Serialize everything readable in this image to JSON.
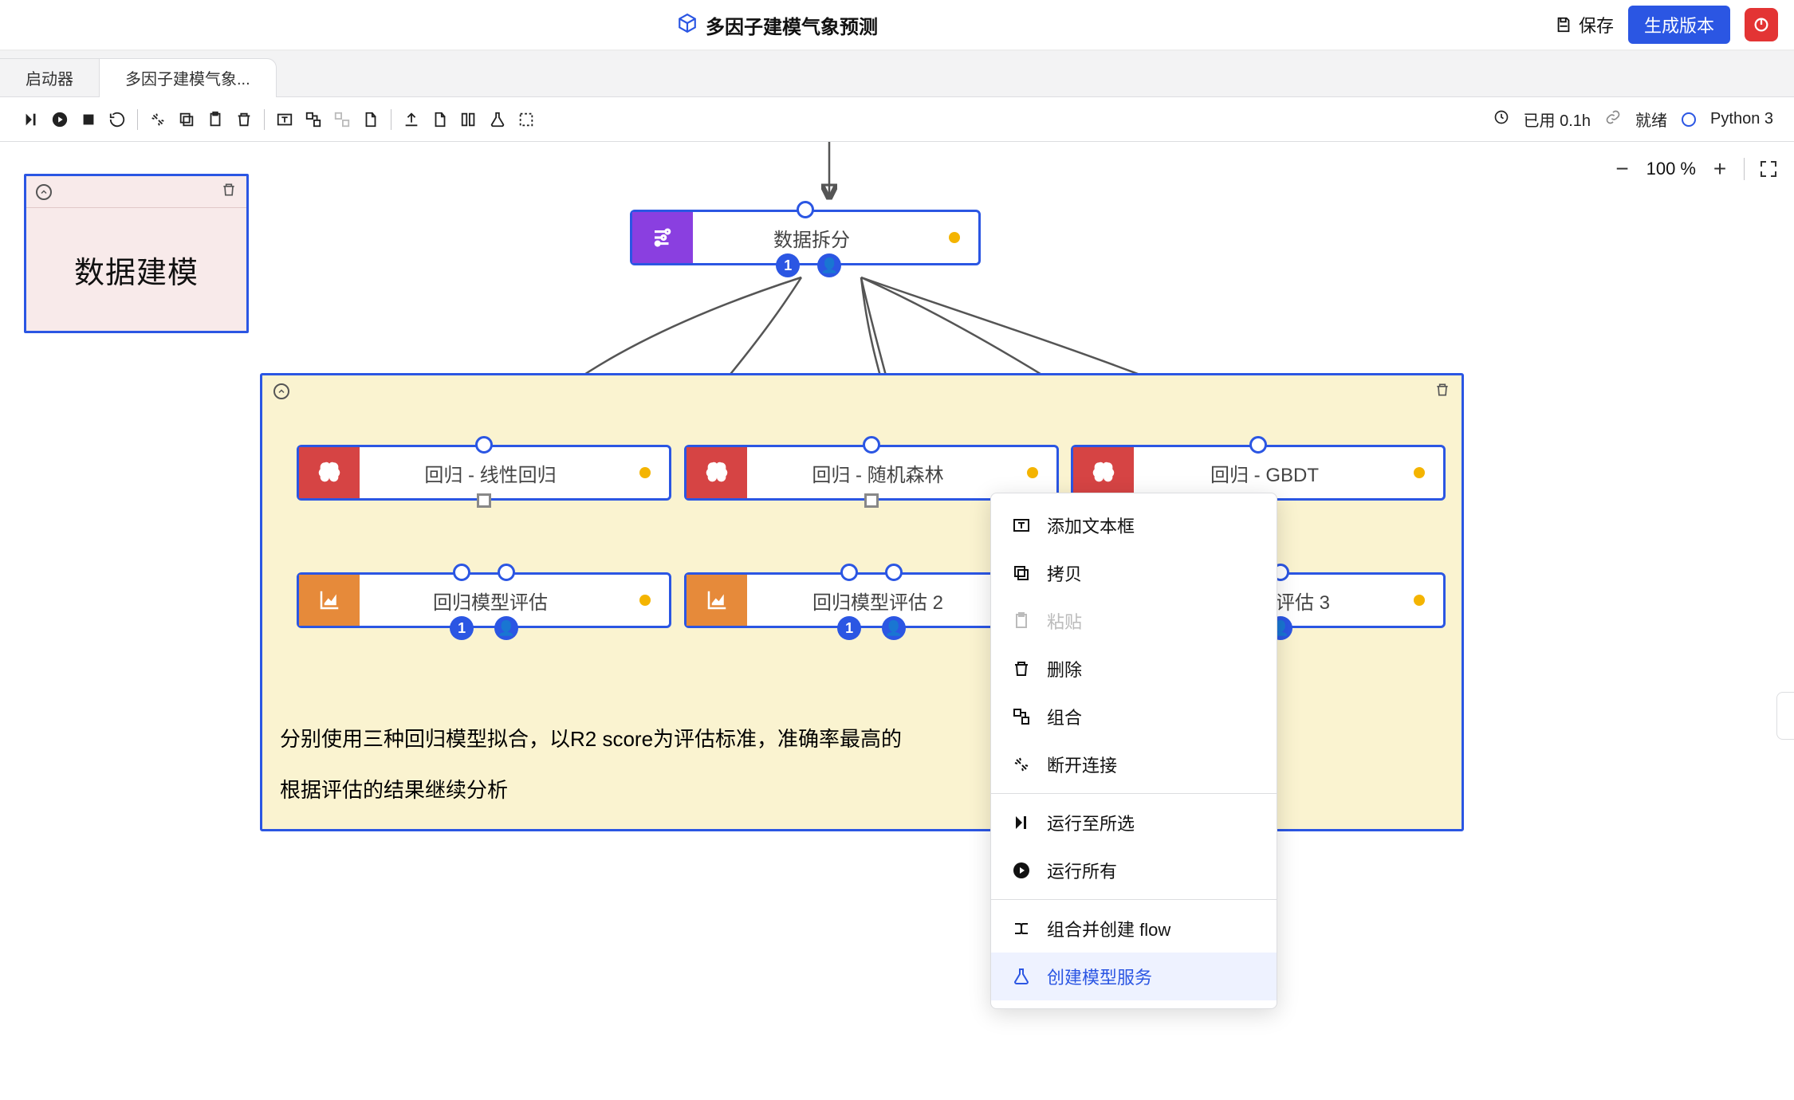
{
  "titlebar": {
    "title": "多因子建模气象预测",
    "save_label": "保存",
    "generate_label": "生成版本"
  },
  "tabs": {
    "launcher": "启动器",
    "active": "多因子建模气象..."
  },
  "toolbar_status": {
    "used_prefix": "已用",
    "used_value": "0.1h",
    "ready": "就绪",
    "kernel": "Python 3"
  },
  "zoom": {
    "value": "100 %"
  },
  "note": {
    "text": "数据建模"
  },
  "nodes": {
    "split": "数据拆分",
    "reg_linear": "回归 - 线性回归",
    "reg_rf": "回归 - 随机森林",
    "reg_gbdt": "回归 - GBDT",
    "eval1": "回归模型评估",
    "eval2": "回归模型评估 2",
    "eval3": "回归模型评估 3"
  },
  "group_text": {
    "line1": "分别使用三种回归模型拟合，以R2 score为评估标准，准确率最高的",
    "line2": "根据评估的结果继续分析"
  },
  "context_menu": {
    "add_text": "添加文本框",
    "copy": "拷贝",
    "paste": "粘贴",
    "delete": "删除",
    "combine": "组合",
    "disconnect": "断开连接",
    "run_to": "运行至所选",
    "run_all": "运行所有",
    "combine_flow": "组合并创建 flow",
    "create_service": "创建模型服务"
  }
}
